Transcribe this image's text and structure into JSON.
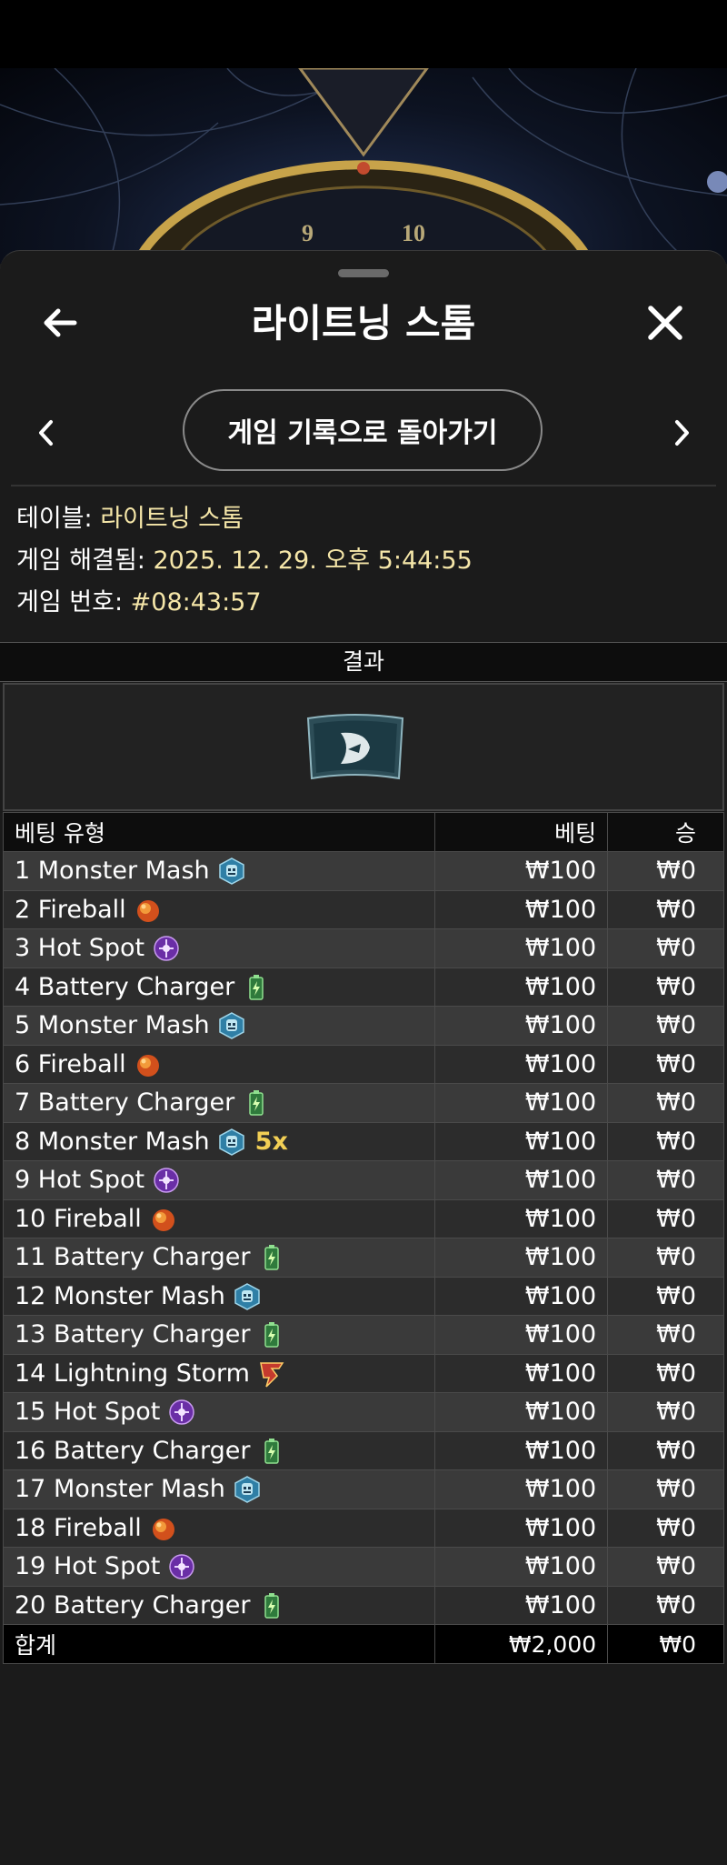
{
  "header": {
    "title": "라이트닝 스톰"
  },
  "nav": {
    "history_button": "게임 기록으로 돌아가기"
  },
  "info": {
    "table_label": "테이블:",
    "table_value": "라이트닝 스톰",
    "resolved_label": "게임 해결됨:",
    "resolved_value": "2025. 12. 29. 오후 5:44:55",
    "game_no_label": "게임 번호:",
    "game_no_value": "#08:43:57"
  },
  "hero": {
    "wheel_numbers": [
      "9",
      "10"
    ]
  },
  "result": {
    "heading": "결과",
    "symbol": "resolved-symbol"
  },
  "bets": {
    "columns": [
      "베팅 유형",
      "베팅",
      "승"
    ],
    "rows": [
      {
        "label": "1 Monster Mash",
        "icon": "monster-mash-icon",
        "bet": "₩100",
        "win": "₩0"
      },
      {
        "label": "2 Fireball",
        "icon": "fireball-icon",
        "bet": "₩100",
        "win": "₩0"
      },
      {
        "label": "3 Hot Spot",
        "icon": "hot-spot-icon",
        "bet": "₩100",
        "win": "₩0"
      },
      {
        "label": "4 Battery Charger",
        "icon": "battery-charger-icon",
        "bet": "₩100",
        "win": "₩0"
      },
      {
        "label": "5 Monster Mash",
        "icon": "monster-mash-icon",
        "bet": "₩100",
        "win": "₩0"
      },
      {
        "label": "6 Fireball",
        "icon": "fireball-icon",
        "bet": "₩100",
        "win": "₩0"
      },
      {
        "label": "7 Battery Charger",
        "icon": "battery-charger-icon",
        "bet": "₩100",
        "win": "₩0"
      },
      {
        "label": "8 Monster Mash",
        "icon": "monster-mash-icon",
        "bet": "₩100",
        "win": "₩0",
        "multiplier": "5x"
      },
      {
        "label": "9 Hot Spot",
        "icon": "hot-spot-icon",
        "bet": "₩100",
        "win": "₩0"
      },
      {
        "label": "10 Fireball",
        "icon": "fireball-icon",
        "bet": "₩100",
        "win": "₩0"
      },
      {
        "label": "11 Battery Charger",
        "icon": "battery-charger-icon",
        "bet": "₩100",
        "win": "₩0"
      },
      {
        "label": "12 Monster Mash",
        "icon": "monster-mash-icon",
        "bet": "₩100",
        "win": "₩0"
      },
      {
        "label": "13 Battery Charger",
        "icon": "battery-charger-icon",
        "bet": "₩100",
        "win": "₩0"
      },
      {
        "label": "14 Lightning Storm",
        "icon": "lightning-storm-icon",
        "bet": "₩100",
        "win": "₩0"
      },
      {
        "label": "15 Hot Spot",
        "icon": "hot-spot-icon",
        "bet": "₩100",
        "win": "₩0"
      },
      {
        "label": "16 Battery Charger",
        "icon": "battery-charger-icon",
        "bet": "₩100",
        "win": "₩0"
      },
      {
        "label": "17 Monster Mash",
        "icon": "monster-mash-icon",
        "bet": "₩100",
        "win": "₩0"
      },
      {
        "label": "18 Fireball",
        "icon": "fireball-icon",
        "bet": "₩100",
        "win": "₩0"
      },
      {
        "label": "19 Hot Spot",
        "icon": "hot-spot-icon",
        "bet": "₩100",
        "win": "₩0"
      },
      {
        "label": "20 Battery Charger",
        "icon": "battery-charger-icon",
        "bet": "₩100",
        "win": "₩0"
      }
    ],
    "total": {
      "label": "합계",
      "bet": "₩2,000",
      "win": "₩0"
    }
  }
}
